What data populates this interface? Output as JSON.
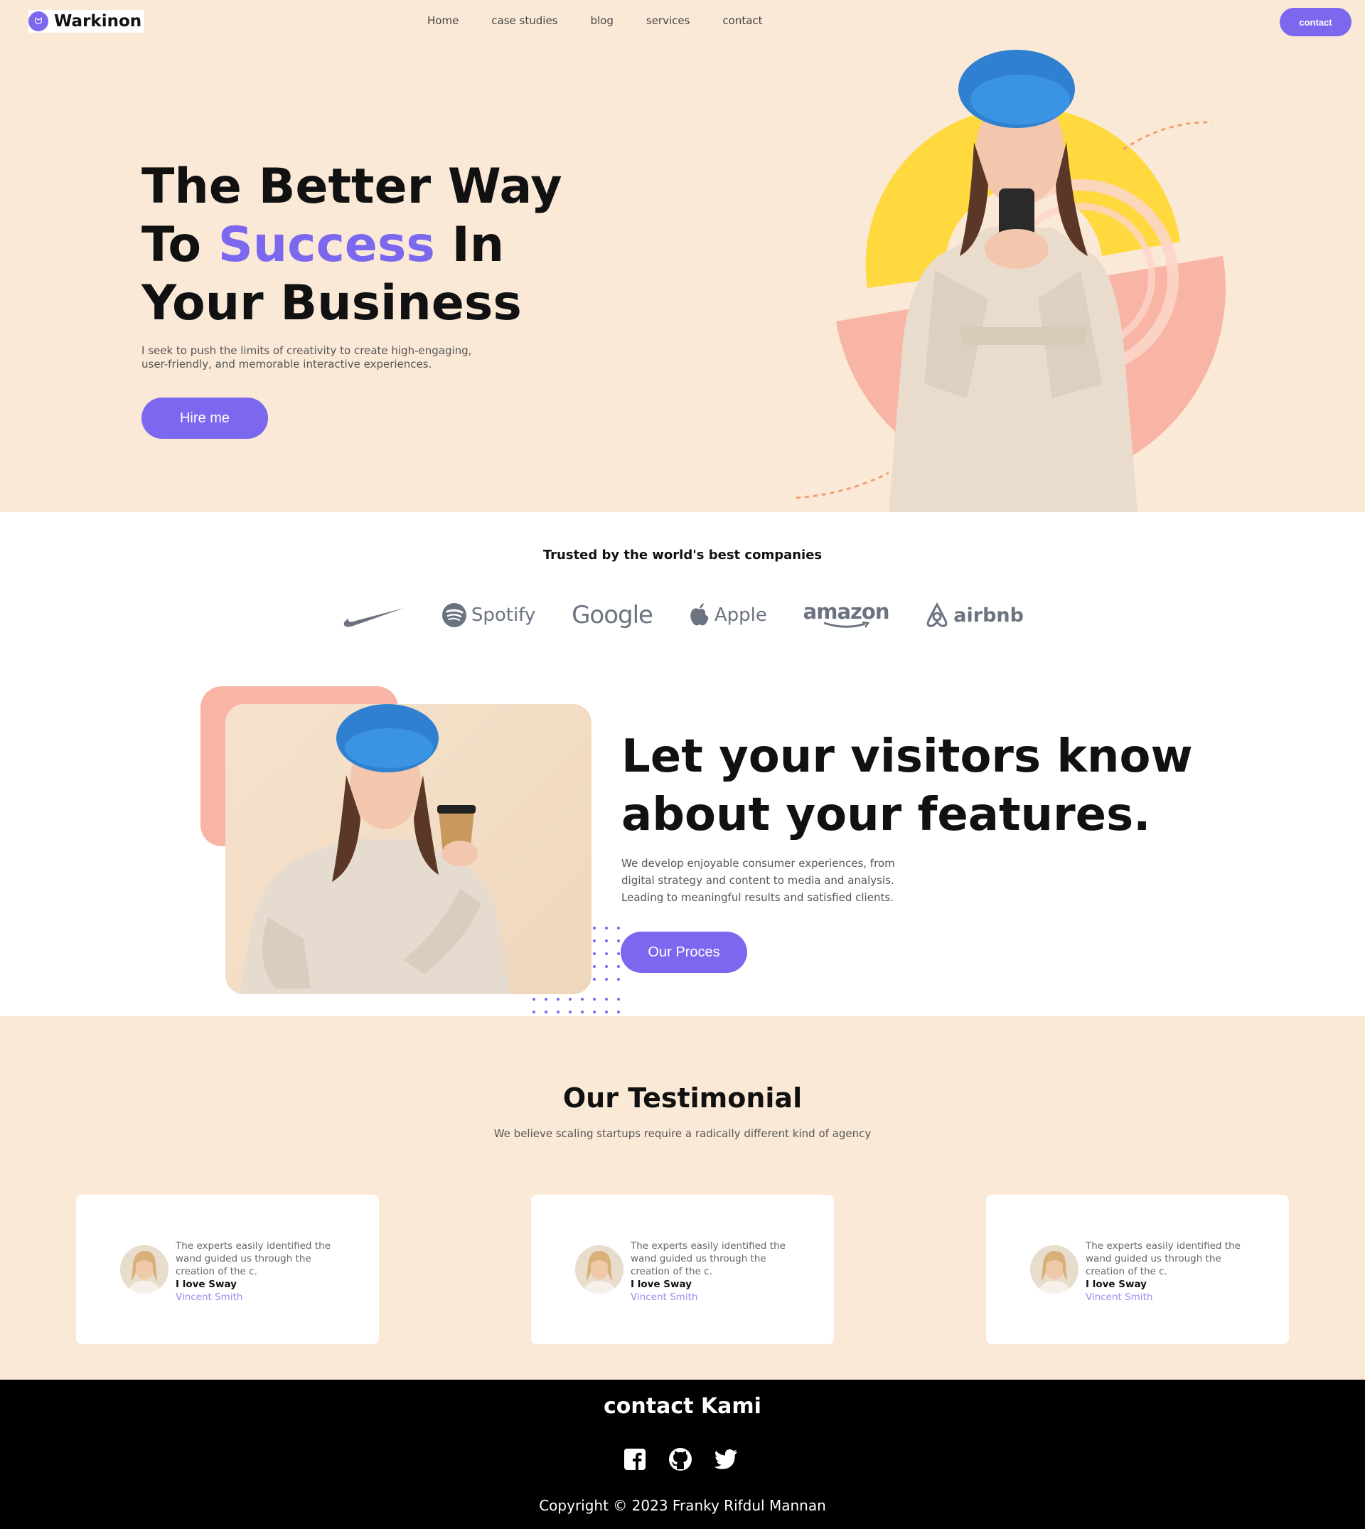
{
  "header": {
    "brand": "Warkinon",
    "nav": [
      "Home",
      "case studies",
      "blog",
      "services",
      "contact"
    ],
    "contact_button": "contact"
  },
  "hero": {
    "title_part1": "The Better Way",
    "title_to": "To ",
    "title_accent": "Success",
    "title_in": " In",
    "title_part3": "Your Business",
    "description": "I seek to push the limits of creativity to create high-engaging, user-friendly, and memorable interactive experiences.",
    "cta": "Hire me"
  },
  "trusted": {
    "title": "Trusted by the world's best companies",
    "logos": [
      "nike",
      "Spotify",
      "Google",
      "Apple",
      "amazon",
      "airbnb"
    ]
  },
  "features": {
    "title": "Let your visitors know about your features.",
    "description": "We develop enjoyable consumer experiences, from digital strategy and content to media and analysis. Leading to meaningful results and satisfied clients.",
    "cta": "Our Proces"
  },
  "testimonial": {
    "title": "Our Testimonial",
    "subtitle": "We believe scaling startups require a radically different kind of agency",
    "cards": [
      {
        "quote": "The experts easily identified the wand guided us through the creation of the c.",
        "name": "I love Sway",
        "author": "Vincent Smith"
      },
      {
        "quote": "The experts easily identified the wand guided us through the creation of the c.",
        "name": "I love Sway",
        "author": "Vincent Smith"
      },
      {
        "quote": "The experts easily identified the wand guided us through the creation of the c.",
        "name": "I love Sway",
        "author": "Vincent Smith"
      }
    ]
  },
  "footer": {
    "title": "contact Kami",
    "social": [
      "facebook-icon",
      "github-icon",
      "twitter-icon"
    ],
    "copyright": "Copyright © 2023 Franky Rifdul Mannan"
  },
  "colors": {
    "accent": "#7b68ee",
    "hero_bg": "#fae9d6",
    "salmon": "#f8b4a4",
    "yellow": "#ffd93d",
    "footer_bg": "#000000"
  }
}
